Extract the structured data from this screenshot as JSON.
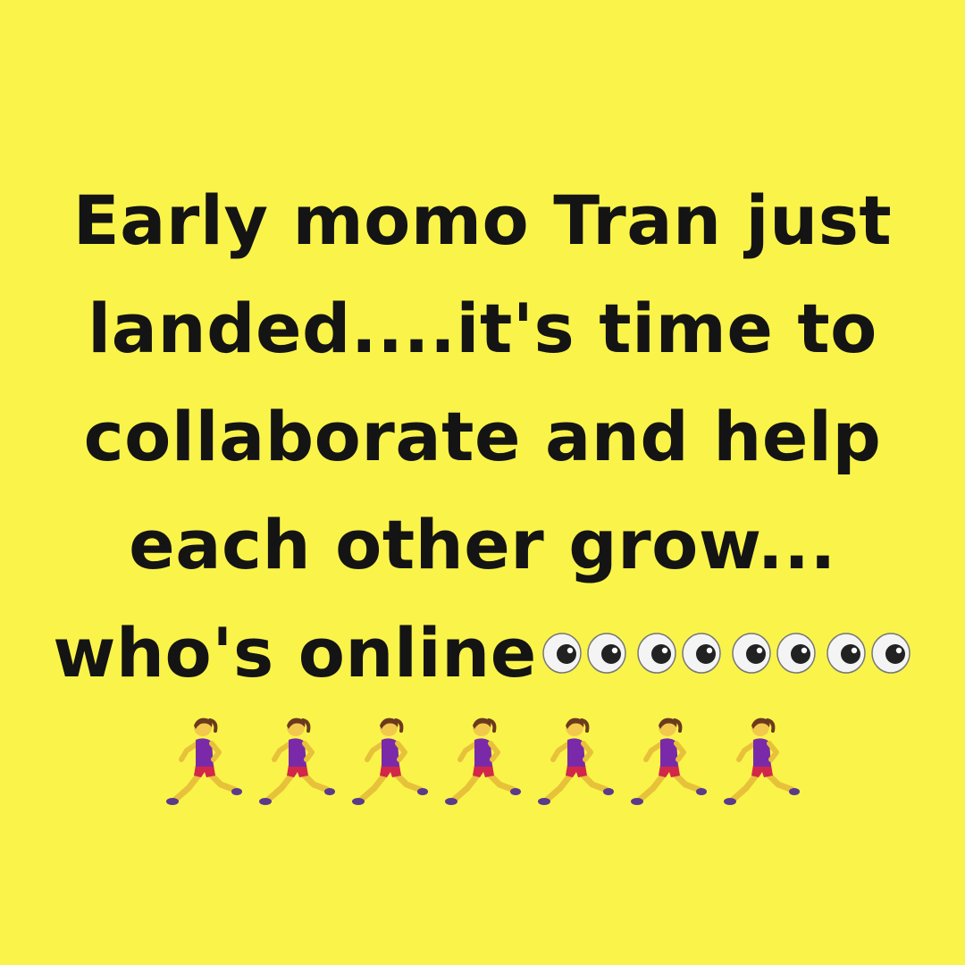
{
  "colors": {
    "background": "#faf44a",
    "text": "#141414"
  },
  "message": {
    "lines": [
      "Early momo Tran just",
      "landed....it's time to",
      "collaborate and help",
      "each other grow...",
      "who's online"
    ]
  },
  "emoji": {
    "eyes": {
      "name": "eyes-icon",
      "count": 4
    },
    "runners": {
      "name": "woman-running-icon",
      "count": 7
    }
  }
}
